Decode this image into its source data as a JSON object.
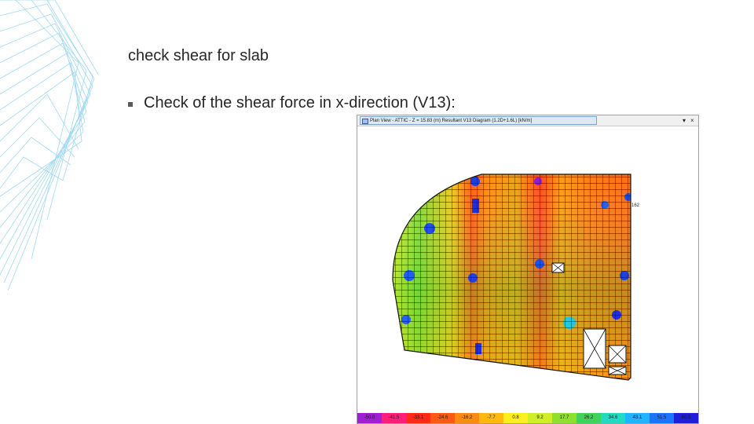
{
  "slide": {
    "title": "check shear for slab",
    "bullet": "Check of the shear force in x-direction (V13):"
  },
  "window": {
    "title": "Plan View - ATTIC - Z = 15.83 (m)   Resultant V13 Diagram   (1.2D+1.6L)  [kN/m]",
    "dropdown_icon": "▾",
    "close_icon": "×",
    "grid_label": "162"
  },
  "colorbar": {
    "labels": [
      "-50.0",
      "-41.5",
      "-33.1",
      "-24.6",
      "-16.2",
      "-7.7",
      "0.8",
      "9.2",
      "17.7",
      "26.2",
      "34.6",
      "43.1",
      "51.5",
      "60.0"
    ],
    "colors": [
      "#9d1fd6",
      "#ff1f7a",
      "#ff2a1a",
      "#ff5a12",
      "#ff8a10",
      "#ffba10",
      "#ffee20",
      "#cfee25",
      "#8ee030",
      "#42d15a",
      "#22d9c2",
      "#1fb4ff",
      "#1f74ff",
      "#1f1fd9"
    ]
  }
}
